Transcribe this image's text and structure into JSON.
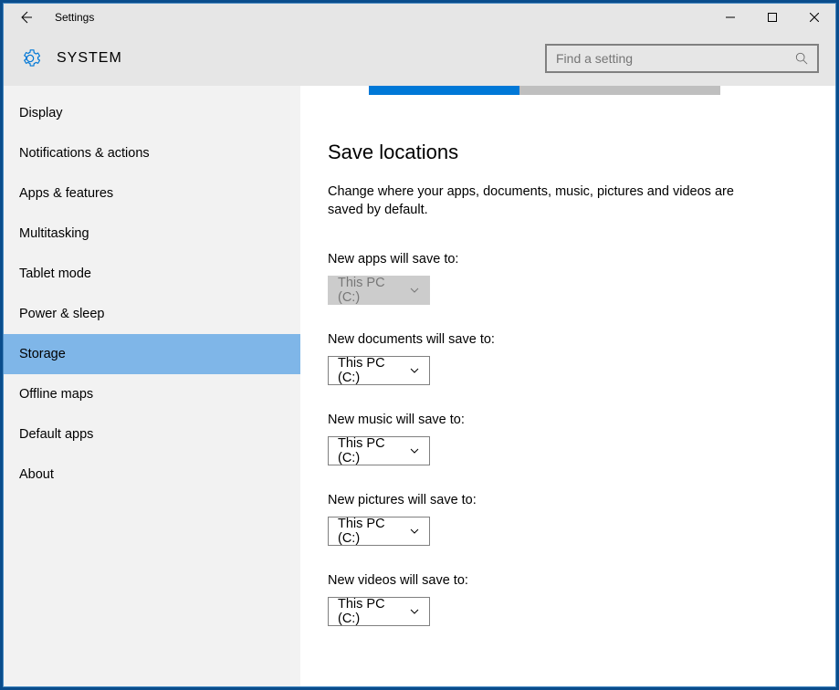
{
  "titlebar": {
    "title": "Settings"
  },
  "header": {
    "title": "SYSTEM",
    "search_placeholder": "Find a setting"
  },
  "sidebar": {
    "items": [
      {
        "label": "Display",
        "selected": false
      },
      {
        "label": "Notifications & actions",
        "selected": false
      },
      {
        "label": "Apps & features",
        "selected": false
      },
      {
        "label": "Multitasking",
        "selected": false
      },
      {
        "label": "Tablet mode",
        "selected": false
      },
      {
        "label": "Power & sleep",
        "selected": false
      },
      {
        "label": "Storage",
        "selected": true
      },
      {
        "label": "Offline maps",
        "selected": false
      },
      {
        "label": "Default apps",
        "selected": false
      },
      {
        "label": "About",
        "selected": false
      }
    ]
  },
  "main": {
    "section_title": "Save locations",
    "section_desc": "Change where your apps, documents, music, pictures and videos are saved by default.",
    "settings": [
      {
        "label": "New apps will save to:",
        "value": "This PC (C:)",
        "disabled": true
      },
      {
        "label": "New documents will save to:",
        "value": "This PC (C:)",
        "disabled": false
      },
      {
        "label": "New music will save to:",
        "value": "This PC (C:)",
        "disabled": false
      },
      {
        "label": "New pictures will save to:",
        "value": "This PC (C:)",
        "disabled": false
      },
      {
        "label": "New videos will save to:",
        "value": "This PC (C:)",
        "disabled": false
      }
    ]
  }
}
